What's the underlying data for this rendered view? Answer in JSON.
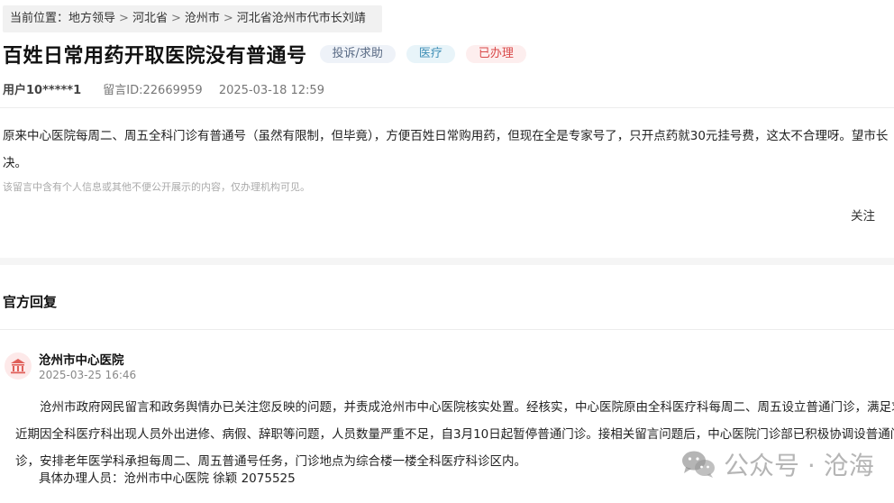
{
  "breadcrumb": {
    "prefix": "当前位置：",
    "items": [
      "地方领导",
      "河北省",
      "沧州市",
      "河北省沧州市代市长刘靖"
    ],
    "separator": ">"
  },
  "post": {
    "title": "百姓日常用药开取医院没有普通号",
    "tags": [
      "投诉/求助",
      "医疗",
      "已办理"
    ],
    "user": "用户10*****1",
    "message_id": "留言ID:22669959",
    "datetime": "2025-03-18 12:59",
    "content": "原来中心医院每周二、周五全科门诊有普通号（虽然有限制，但毕竟），方便百姓日常购用药，但现在全是专家号了，只开点药就30元挂号费，这太不合理呀。望市长",
    "content_tail": "决。",
    "privacy_note": "该留言中含有个人信息或其他不便公开展示的内容，仅办理机构可见。",
    "follow_label": "关注"
  },
  "reply": {
    "heading": "官方回复",
    "org_name": "沧州市中心医院",
    "datetime": "2025-03-25 16:46",
    "body": "沧州市政府网民留言和政务舆情办已关注您反映的问题，并责成沧州市中心医院核实处置。经核实，中心医院原由全科医疗科每周二、周五设立普通门诊，满足求，近期因全科医疗科出现人员外出进修、病假、辞职等问题，人员数量严重不足，自3月10日起暂停普通门诊。接相关留言问题后，中心医院门诊部已积极协调设普通门诊，安排老年医学科承担每周二、周五普通号任务，门诊地点为综合楼一楼全科医疗科诊区内。",
    "handler": "具体办理人员：沧州市中心医院  徐颖  2075525"
  },
  "watermark": {
    "text": "公众号 · 沧海",
    "icon": "wechat-icon"
  },
  "colors": {
    "tag_status": "#d94a4a",
    "tag_field": "#3d8db5",
    "avatar_icon": "#e0605a"
  }
}
